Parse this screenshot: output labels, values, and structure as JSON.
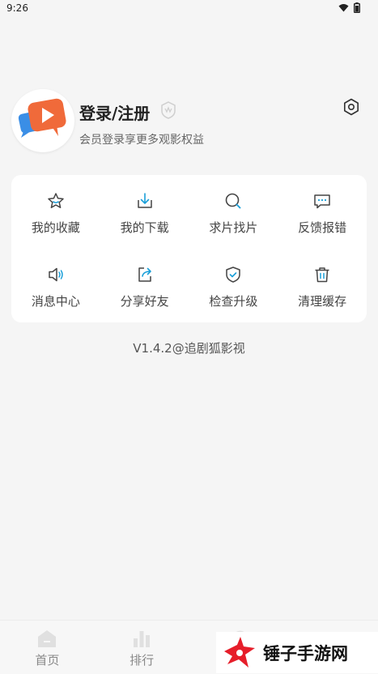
{
  "status_bar": {
    "time": "9:26"
  },
  "profile": {
    "title": "登录/注册",
    "subtitle": "会员登录享更多观影权益"
  },
  "menu": {
    "items": [
      {
        "label": "我的收藏",
        "icon": "star-icon"
      },
      {
        "label": "我的下载",
        "icon": "download-icon"
      },
      {
        "label": "求片找片",
        "icon": "search-icon"
      },
      {
        "label": "反馈报错",
        "icon": "feedback-icon"
      },
      {
        "label": "消息中心",
        "icon": "speaker-icon"
      },
      {
        "label": "分享好友",
        "icon": "share-icon"
      },
      {
        "label": "检查升级",
        "icon": "shield-icon"
      },
      {
        "label": "清理缓存",
        "icon": "trash-icon"
      }
    ]
  },
  "version": "V1.4.2@追剧狐影视",
  "tabbar": {
    "tabs": [
      {
        "label": "首页",
        "icon": "home-icon"
      },
      {
        "label": "排行",
        "icon": "bar-chart-icon"
      }
    ]
  },
  "watermark": {
    "text": "锤子手游网"
  },
  "colors": {
    "accent": "#1a9fd9",
    "icon_gray": "#555555",
    "card": "#ffffff",
    "background": "#f5f5f5"
  }
}
